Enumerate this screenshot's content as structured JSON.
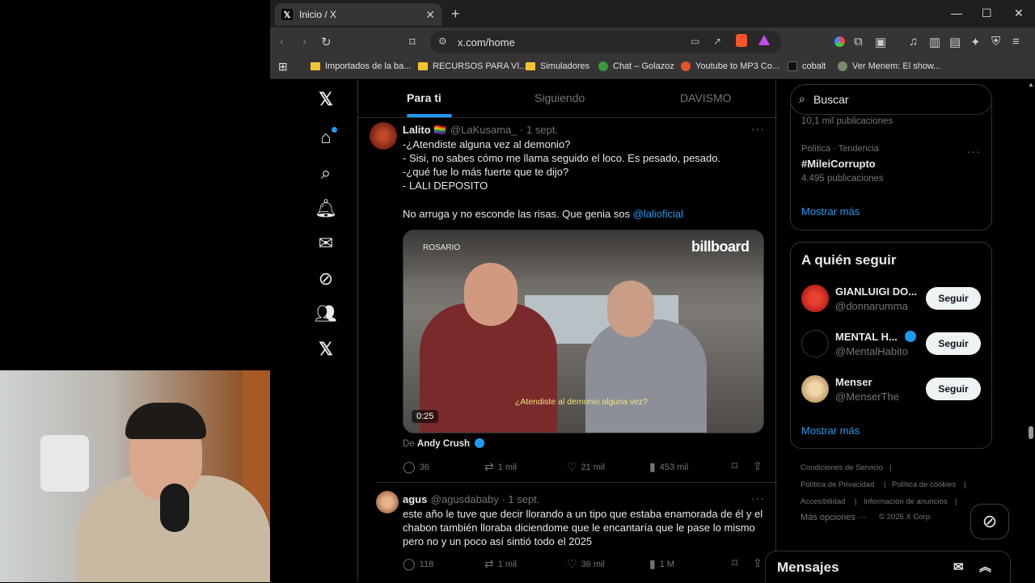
{
  "browser": {
    "tab_title": "Inicio / X",
    "tab_close": "✕",
    "new_tab": "+",
    "url": "x.com/home",
    "window_controls": [
      "—",
      "☐",
      "✕"
    ],
    "bookmarks": [
      {
        "label": "Importados de la ba...",
        "icon": "folder"
      },
      {
        "label": "RECURSOS PARA VI...",
        "icon": "folder"
      },
      {
        "label": "Simuladores",
        "icon": "folder"
      },
      {
        "label": "Chat – Golazoz",
        "icon": "globe-green"
      },
      {
        "label": "Youtube to MP3 Co...",
        "icon": "globe-orange"
      },
      {
        "label": "cobalt",
        "icon": "cobalt"
      },
      {
        "label": "Ver Menem: El show...",
        "icon": "menem"
      }
    ]
  },
  "feed": {
    "tabs": [
      "Para ti",
      "Siguiendo",
      "DAVISMO"
    ],
    "posts": [
      {
        "name": "Lalito 🏳️‍🌈",
        "handle": "@LaKusama_ · 1 sept.",
        "text": "-¿Atendiste alguna vez al demonio?\n- Sisi, no sabes cómo me llama seguido el loco. Es pesado, pesado.\n-¿qué fue lo más fuerte que te dijo?\n- LALI DEPOSITO",
        "text2": "No arruga y no esconde las risas. Que genia sos ",
        "mention": "@lalioficial",
        "media": {
          "location": "ROSARIO",
          "brand": "billboard",
          "caption": "¿Atendiste al demonio alguna vez?",
          "duration": "0:25"
        },
        "source_prefix": "De ",
        "source": "Andy Crush",
        "replies": "36",
        "reposts": "1 mil",
        "likes": "21 mil",
        "views": "453 mil"
      },
      {
        "name": "agus",
        "handle": "@agusdababy · 1 sept.",
        "text": "este año le tuve que decir llorando a un tipo que estaba enamorada de él y el chabon también lloraba diciendome que le encantaría que le pase lo mismo pero no y un poco así sintió todo el 2025",
        "replies": "118",
        "reposts": "1 mil",
        "likes": "36 mil",
        "views": "1 M"
      }
    ]
  },
  "sidebar_right": {
    "search_placeholder": "Buscar",
    "trend_top_count": "10,1 mil publicaciones",
    "trend": {
      "category": "Política · Tendencia",
      "name": "#MileiCorrupto",
      "count": "4.495 publicaciones"
    },
    "show_more": "Mostrar más",
    "who_to_follow_title": "A quién seguir",
    "who_to_follow": [
      {
        "name": "GIANLUIGI DO...",
        "handle": "@donnarumma",
        "button": "Seguir"
      },
      {
        "name": "MENTAL H...",
        "handle": "@MentalHabito",
        "button": "Seguir"
      },
      {
        "name": "Menser",
        "handle": "@MenserThe",
        "button": "Seguir"
      }
    ],
    "footer": [
      "Condiciones de Servicio",
      "Política de Privacidad",
      "Política de cookies",
      "Accesibilidad",
      "Información de anuncios",
      "Más opciones ···",
      "© 2025 X Corp."
    ],
    "messages": "Mensajes"
  }
}
